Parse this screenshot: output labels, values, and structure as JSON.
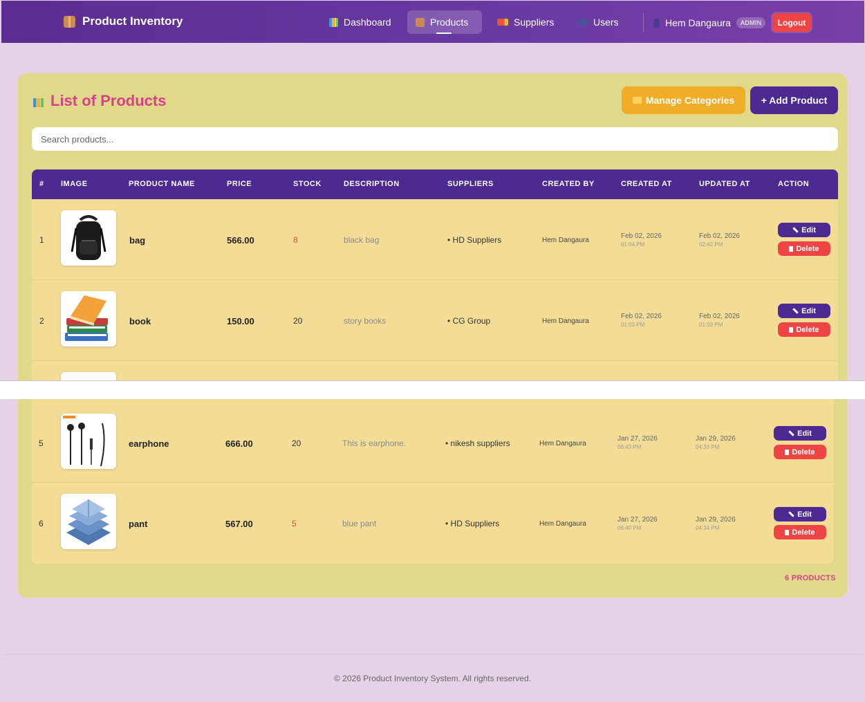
{
  "nav": {
    "brand": "Product Inventory",
    "links": [
      {
        "label": "Dashboard"
      },
      {
        "label": "Products"
      },
      {
        "label": "Suppliers"
      },
      {
        "label": "Users"
      }
    ],
    "user_name": "Hem Dangaura",
    "role": "ADMIN",
    "logout": "Logout"
  },
  "page": {
    "title": "List of Products",
    "manage_categories": "Manage Categories",
    "add_product": "+ Add Product",
    "search_placeholder": "Search products..."
  },
  "table": {
    "headers": [
      "#",
      "IMAGE",
      "PRODUCT NAME",
      "PRICE",
      "STOCK",
      "DESCRIPTION",
      "SUPPLIERS",
      "CREATED BY",
      "CREATED AT",
      "UPDATED AT",
      "ACTION"
    ],
    "rows": [
      {
        "num": "1",
        "name": "bag",
        "price": "566.00",
        "stock": "8",
        "description": "black bag",
        "supplier": "• HD Suppliers",
        "created_by": "Hem Dangaura",
        "created_date": "Feb 02, 2026",
        "created_time": "01:04 PM",
        "updated_date": "Feb 02, 2026",
        "updated_time": "02:42 PM"
      },
      {
        "num": "2",
        "name": "book",
        "price": "150.00",
        "stock": "20",
        "description": "story books",
        "supplier": "• CG Group",
        "created_by": "Hem Dangaura",
        "created_date": "Feb 02, 2026",
        "created_time": "01:03 PM",
        "updated_date": "Feb 02, 2026",
        "updated_time": "01:03 PM"
      },
      {
        "num": "5",
        "name": "earphone",
        "price": "666.00",
        "stock": "20",
        "description": "This is earphone.",
        "supplier": "• nikesh suppliers",
        "created_by": "Hem Dangaura",
        "created_date": "Jan 27, 2026",
        "created_time": "06:43 PM",
        "updated_date": "Jan 29, 2026",
        "updated_time": "04:33 PM"
      },
      {
        "num": "6",
        "name": "pant",
        "price": "567.00",
        "stock": "5",
        "description": "blue pant",
        "supplier": "• HD Suppliers",
        "created_by": "Hem Dangaura",
        "created_date": "Jan 27, 2026",
        "created_time": "06:40 PM",
        "updated_date": "Jan 29, 2026",
        "updated_time": "04:34 PM"
      }
    ],
    "edit_label": "Edit",
    "delete_label": "Delete"
  },
  "product_count": "6 PRODUCTS",
  "footer": "© 2026 Product Inventory System. All rights reserved.",
  "colors": {
    "nav": "#5b2d91",
    "accent": "#4c2a91",
    "title": "#d9408a",
    "card": "#e0d989",
    "row": "#f2dc96",
    "danger": "#ef4444",
    "warning": "#f0ad27"
  }
}
